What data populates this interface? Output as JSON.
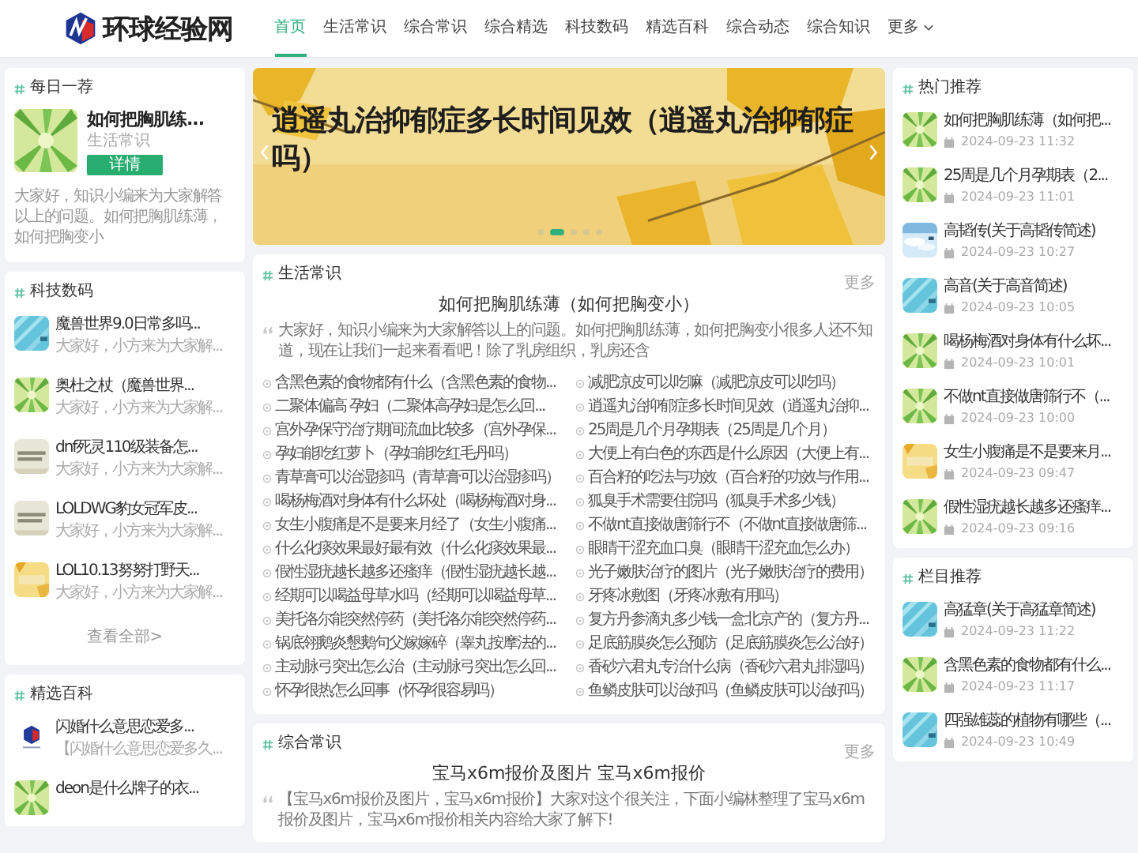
{
  "header": {
    "logo_text": "环球经验网",
    "nav": [
      {
        "label": "首页",
        "selected": true,
        "kind": "link"
      },
      {
        "label": "生活常识",
        "selected": false,
        "kind": "link"
      },
      {
        "label": "综合常识",
        "selected": false,
        "kind": "link"
      },
      {
        "label": "综合精选",
        "selected": false,
        "kind": "link"
      },
      {
        "label": "科技数码",
        "selected": false,
        "kind": "link"
      },
      {
        "label": "精选百科",
        "selected": false,
        "kind": "link"
      },
      {
        "label": "综合动态",
        "selected": false,
        "kind": "link"
      },
      {
        "label": "综合知识",
        "selected": false,
        "kind": "link"
      },
      {
        "label": "更多",
        "selected": false,
        "kind": "dropdown"
      }
    ]
  },
  "daily_pick": {
    "heading": "每日一荐",
    "title": "如何把胸肌练...",
    "category": "生活常识",
    "button": "详情",
    "intro": "大家好，知识小编来为大家解答以上的问题。如何把胸肌练薄，如何把胸变小"
  },
  "tech": {
    "heading": "科技数码",
    "items": [
      {
        "title": "魔兽世界9.0日常多吗...",
        "snippet": "大家好，小方来为大家解..."
      },
      {
        "title": "奥杜之杖（魔兽世界...",
        "snippet": "大家好，小方来为大家解..."
      },
      {
        "title": "dnf死灵110级装备怎...",
        "snippet": "大家好，小方来为大家解..."
      },
      {
        "title": "LOLDWG豹女冠军皮...",
        "snippet": "大家好，小方来为大家解..."
      },
      {
        "title": "LOL10.13努努打野天...",
        "snippet": "大家好，小方来为大家解..."
      }
    ],
    "footer": "查看全部>"
  },
  "featured": {
    "heading": "精选百科",
    "items": [
      {
        "title": "闪婚什么意思恋爱多...",
        "snippet": "【闪婚什么意思恋爱多久..."
      },
      {
        "title": "deon是什么牌子的衣..."
      }
    ]
  },
  "banner": {
    "title": "逍遥丸治抑郁症多长时间见效（逍遥丸治抑郁症吗）",
    "slides": [
      {
        "selected": false
      },
      {
        "selected": true
      },
      {
        "selected": false
      },
      {
        "selected": false
      },
      {
        "selected": false
      }
    ]
  },
  "sections": [
    {
      "heading": "生活常识",
      "more": "更多",
      "headline": "如何把胸肌练薄（如何把胸变小）",
      "intro": "大家好，知识小编来为大家解答以上的问题。如何把胸肌练薄，如何把胸变小很多人还不知道，现在让我们一起来看看吧！除了乳房组织，乳房还含",
      "links": [
        "含黑色素的食物都有什么（含黑色素的食物...",
        "减肥凉皮可以吃嘛（减肥凉皮可以吃吗）",
        "二聚体偏高 孕妇（二聚体高孕妇是怎么回...",
        "逍遥丸治抑郁症多长时间见效（逍遥丸治抑...",
        "宫外孕保守治疗期间流血比较多（宫外孕保...",
        "25周是几个月孕期表（25周是几个月）",
        "孕妇能吃红萝卜（孕妇能吃红毛丹吗）",
        "大便上有白色的东西是什么原因（大便上有...",
        "青草膏可以治湿疹吗（青草膏可以治湿疹吗）",
        "百合籽的吃法与功效（百合籽的功效与作用...",
        "喝杨梅酒对身体有什么坏处（喝杨梅酒对身...",
        "狐臭手术需要住院吗（狐臭手术多少钱）",
        "女生小腹痛是不是要来月经了（女生小腹痛...",
        "不做nt直接做唐筛行不（不做nt直接做唐筛...",
        "什么化痰效果最好最有效（什么化痰效果最...",
        "眼睛干涩充血口臭（眼睛干涩充血怎么办）",
        "假性湿疣越长越多还瘙痒（假性湿疣越长越...",
        "光子嫩肤治疗的图片（光子嫩肤治疗的费用）",
        "经期可以喝益母草水吗（经期可以喝益母草...",
        "牙疼冰敷图（牙疼冰敷有用吗）",
        "美托洛尔能突然停药（美托洛尔能突然停药...",
        "复方丹参滴丸多少钱一盒北京产的（复方丹...",
        "锅底翎鹅炎懇鹅句父嫁嫁碎（睾丸按摩法的...",
        "足底筋膜炎怎么预防（足底筋膜炎怎么治好）",
        "主动脉弓突出怎么治（主动脉弓突出怎么回...",
        "香砂六君丸专治什么病（香砂六君丸排湿吗）",
        "怀孕很热怎么回事（怀孕很容易吗）",
        "鱼鳞皮肤可以治好吗（鱼鳞皮肤可以治好吗）"
      ]
    },
    {
      "heading": "综合常识",
      "more": "更多",
      "headline": "宝马x6m报价及图片 宝马x6m报价",
      "intro": "【宝马x6m报价及图片，宝马x6m报价】大家对这个很关注，下面小编林整理了宝马x6m报价及图片，宝马x6m报价相关内容给大家了解下!"
    }
  ],
  "hot": {
    "heading": "热门推荐",
    "items": [
      {
        "title": "如何把胸肌练薄（如何把...",
        "date": "2024-09-23 11:32"
      },
      {
        "title": "25周是几个月孕期表（2...",
        "date": "2024-09-23 11:01"
      },
      {
        "title": "高韬传(关于高韬传简述)",
        "date": "2024-09-23 10:27"
      },
      {
        "title": "高音(关于高音简述)",
        "date": "2024-09-23 10:05"
      },
      {
        "title": "喝杨梅酒对身体有什么坏...",
        "date": "2024-09-23 10:01"
      },
      {
        "title": "不做nt直接做唐筛行不（...",
        "date": "2024-09-23 10:00"
      },
      {
        "title": "女生小腹痛是不是要来月...",
        "date": "2024-09-23 09:47"
      },
      {
        "title": "假性湿疣越长越多还瘙痒...",
        "date": "2024-09-23 09:16"
      }
    ]
  },
  "column_picks": {
    "heading": "栏目推荐",
    "items": [
      {
        "title": "高猛章(关于高猛章简述)",
        "date": "2024-09-23 11:22"
      },
      {
        "title": "含黑色素的食物都有什么...",
        "date": "2024-09-23 11:17"
      },
      {
        "title": "四强雄蕊的植物有哪些（...",
        "date": "2024-09-23 10:49"
      }
    ]
  }
}
